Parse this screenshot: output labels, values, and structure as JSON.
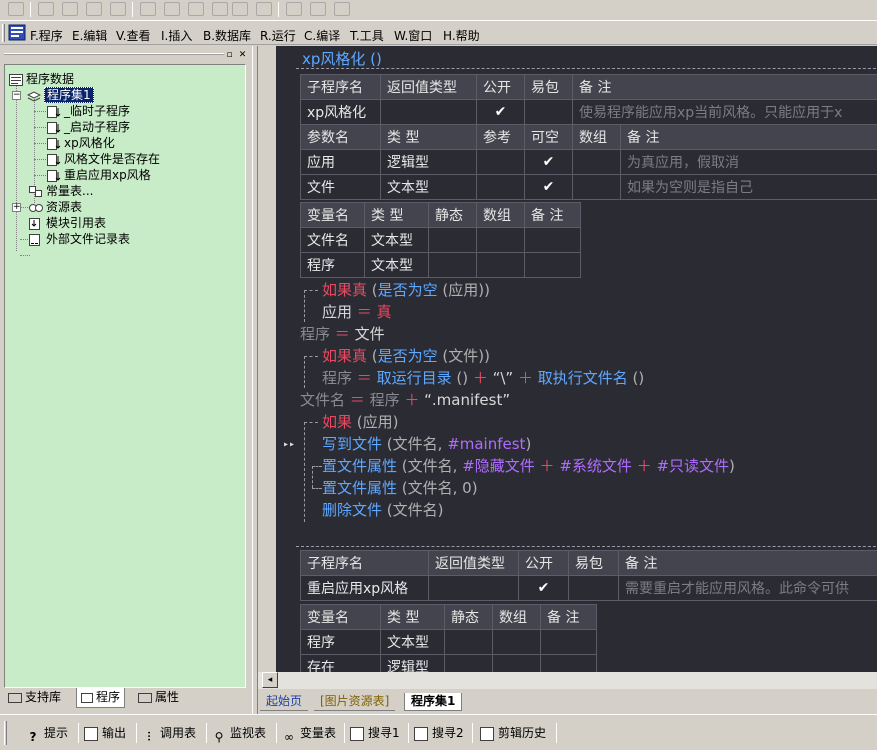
{
  "menu": {
    "items": [
      "F.程序",
      "E.编辑",
      "V.查看",
      "I.插入",
      "B.数据库",
      "R.运行",
      "C.编译",
      "T.工具",
      "W.窗口",
      "H.帮助"
    ]
  },
  "tree": {
    "root": "程序数据",
    "assembly": "程序集1",
    "subs": [
      "_临时子程序",
      "_启动子程序",
      "xp风格化",
      "风格文件是否存在",
      "重启应用xp风格"
    ],
    "constants": "常量表...",
    "resources": "资源表",
    "modules": "模块引用表",
    "external": "外部文件记录表"
  },
  "left_tabs": [
    "支持库",
    "程序",
    "属性"
  ],
  "editor": {
    "title": "xp风格化 ()",
    "sub1": {
      "headers": [
        "子程序名",
        "返回值类型",
        "公开",
        "易包",
        "备 注"
      ],
      "row": [
        "xp风格化",
        "",
        "✔",
        "",
        "使易程序能应用xp当前风格。只能应用于x"
      ],
      "param_headers": [
        "参数名",
        "类 型",
        "参考",
        "可空",
        "数组",
        "备 注"
      ],
      "params": [
        [
          "应用",
          "逻辑型",
          "",
          "✔",
          "",
          "为真应用，假取消"
        ],
        [
          "文件",
          "文本型",
          "",
          "✔",
          "",
          "如果为空则是指自己"
        ]
      ],
      "var_headers": [
        "变量名",
        "类 型",
        "静态",
        "数组",
        "备 注"
      ],
      "vars": [
        [
          "文件名",
          "文本型",
          "",
          "",
          ""
        ],
        [
          "程序",
          "文本型",
          "",
          "",
          ""
        ]
      ]
    },
    "code": {
      "l1_kw": "如果真",
      "l1_rest1": " (",
      "l1_fn": "是否为空",
      "l1_rest2": " (应用))",
      "l2_var": "应用",
      "l2_op": " ＝ ",
      "l2_val": "真",
      "l3_var": "程序",
      "l3_op": " ＝ ",
      "l3_val": "文件",
      "l4_kw": "如果真",
      "l4_rest1": " (",
      "l4_fn": "是否为空",
      "l4_rest2": " (文件))",
      "l5_var": "程序",
      "l5_op1": " ＝ ",
      "l5_fn1": "取运行目录",
      "l5_p1": " () ",
      "l5_op2": "＋",
      "l5_str": " “\\” ",
      "l5_op3": "＋",
      "l5_fn2": " 取执行文件名",
      "l5_p2": " ()",
      "l6_var": "文件名",
      "l6_op1": " ＝ ",
      "l6_v": "程序",
      "l6_op2": " ＋ ",
      "l6_str": "“.manifest”",
      "l7_kw": "如果",
      "l7_rest": " (应用)",
      "l8_fn": "写到文件",
      "l8_p": " (文件名, ",
      "l8_c": "#mainfest",
      "l8_e": ")",
      "l9_fn": "置文件属性",
      "l9_p": " (文件名, ",
      "l9_c1": "#隐藏文件",
      "l9_op1": " ＋ ",
      "l9_c2": "#系统文件",
      "l9_op2": " ＋ ",
      "l9_c3": "#只读文件",
      "l9_e": ")",
      "l10_fn": "置文件属性",
      "l10_p": " (文件名, 0)",
      "l11_fn": "删除文件",
      "l11_p": " (文件名)"
    },
    "sub2": {
      "headers": [
        "子程序名",
        "返回值类型",
        "公开",
        "易包",
        "备 注"
      ],
      "row": [
        "重启应用xp风格",
        "",
        "✔",
        "",
        "需要重启才能应用风格。此命令可供"
      ],
      "var_headers": [
        "变量名",
        "类 型",
        "静态",
        "数组",
        "备 注"
      ],
      "vars": [
        [
          "程序",
          "文本型",
          "",
          "",
          ""
        ],
        [
          "存在",
          "逻辑型",
          "",
          "",
          ""
        ]
      ]
    }
  },
  "doc_tabs": [
    "起始页",
    "[图片资源表]",
    "程序集1"
  ],
  "bottom_tabs": [
    "提示",
    "输出",
    "调用表",
    "监视表",
    "变量表",
    "搜寻1",
    "搜寻2",
    "剪辑历史"
  ],
  "colors": {
    "editor_bg": "#2b2b34",
    "tree_bg": "#c8ecc8",
    "keyword": "#e84a5f",
    "function": "#5fa8ff",
    "constant": "#b06cff"
  }
}
